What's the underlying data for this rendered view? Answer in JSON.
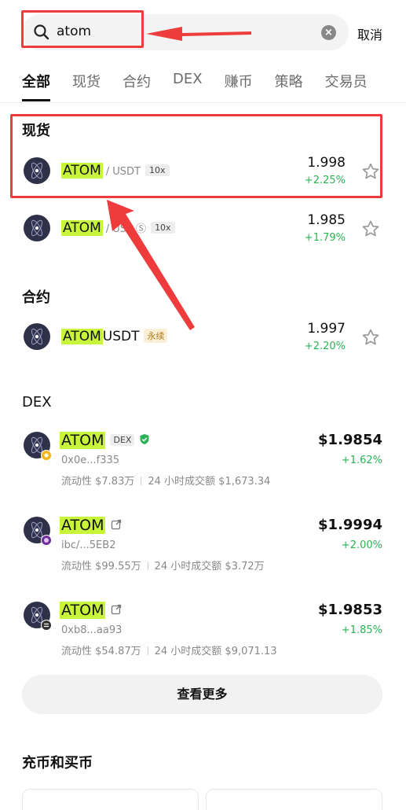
{
  "search": {
    "value": "atom",
    "cancel_label": "取消"
  },
  "tabs": [
    {
      "label": "全部"
    },
    {
      "label": "现货"
    },
    {
      "label": "合约"
    },
    {
      "label": "DEX"
    },
    {
      "label": "赚币"
    },
    {
      "label": "策略"
    },
    {
      "label": "交易员"
    }
  ],
  "spot": {
    "title": "现货",
    "rows": [
      {
        "symbol": "ATOM",
        "quote": "/ USDT",
        "leverage": "10x",
        "price": "1.998",
        "change": "+2.25%"
      },
      {
        "symbol": "ATOM",
        "quote": "/ USD",
        "leverage": "10x",
        "price": "1.985",
        "change": "+1.79%"
      }
    ]
  },
  "futures": {
    "title": "合约",
    "rows": [
      {
        "symbol": "ATOM",
        "suffix": "USDT",
        "tag": "永续",
        "price": "1.997",
        "change": "+2.20%"
      }
    ]
  },
  "dex": {
    "title": "DEX",
    "rows": [
      {
        "symbol": "ATOM",
        "badge": "DEX",
        "address": "0x0e...f335",
        "liquidity": "流动性 $7.83万",
        "volume": "24 小时成交额 $1,673.34",
        "price": "$1.9854",
        "change": "+1.62%"
      },
      {
        "symbol": "ATOM",
        "address": "ibc/...5EB2",
        "liquidity": "流动性 $99.55万",
        "volume": "24 小时成交额 $3.72万",
        "price": "$1.9994",
        "change": "+2.00%"
      },
      {
        "symbol": "ATOM",
        "address": "0xb8...aa93",
        "liquidity": "流动性 $54.87万",
        "volume": "24 小时成交额 $9,071.13",
        "price": "$1.9853",
        "change": "+1.85%"
      }
    ]
  },
  "more_button": "查看更多",
  "deposit": {
    "title": "充币和买币"
  },
  "colors": {
    "highlight": "#c8f53b",
    "positive": "#2db157",
    "annotation": "#ee3b3b"
  },
  "icons": [
    "search-icon",
    "clear-icon",
    "star-icon",
    "cosmos-coin-icon",
    "verified-shield-icon",
    "external-link-icon",
    "annotation-arrow"
  ]
}
